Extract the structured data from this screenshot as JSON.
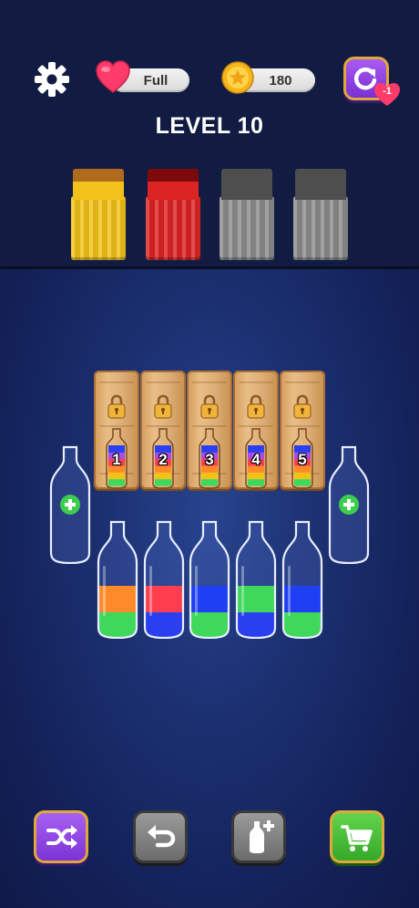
{
  "header": {
    "lives_label": "Full",
    "coins": "180",
    "restart_badge": "-1",
    "level_title": "LEVEL 10"
  },
  "target_boxes": [
    {
      "color": "#f2c21a",
      "lid": "#b06a1e",
      "name": "yellow",
      "open": true
    },
    {
      "color": "#dc2424",
      "lid": "#7d0a0a",
      "name": "red",
      "open": true
    },
    {
      "color": "#8c8c8c",
      "lid": "#4e4e4e",
      "name": "grey",
      "open": false
    },
    {
      "color": "#8c8c8c",
      "lid": "#4e4e4e",
      "name": "grey",
      "open": false
    }
  ],
  "locked_crates": [
    {
      "number": "1"
    },
    {
      "number": "2"
    },
    {
      "number": "3"
    },
    {
      "number": "4"
    },
    {
      "number": "5"
    }
  ],
  "bottles": [
    {
      "layers": [
        "#3fd85b",
        "#ff8a2a"
      ]
    },
    {
      "layers": [
        "#2a3ff0",
        "#ff3f4f"
      ]
    },
    {
      "layers": [
        "#3fd85b",
        "#1e3ff4"
      ]
    },
    {
      "layers": [
        "#2a3ff0",
        "#3fd85b"
      ]
    },
    {
      "layers": [
        "#3fd85b",
        "#1e3ff4"
      ]
    }
  ],
  "colors": {
    "accent_purple": "#8e45e0",
    "shop_green": "#45bf38",
    "gold_border": "#e0a83a",
    "heart": "#ff3b6b"
  }
}
